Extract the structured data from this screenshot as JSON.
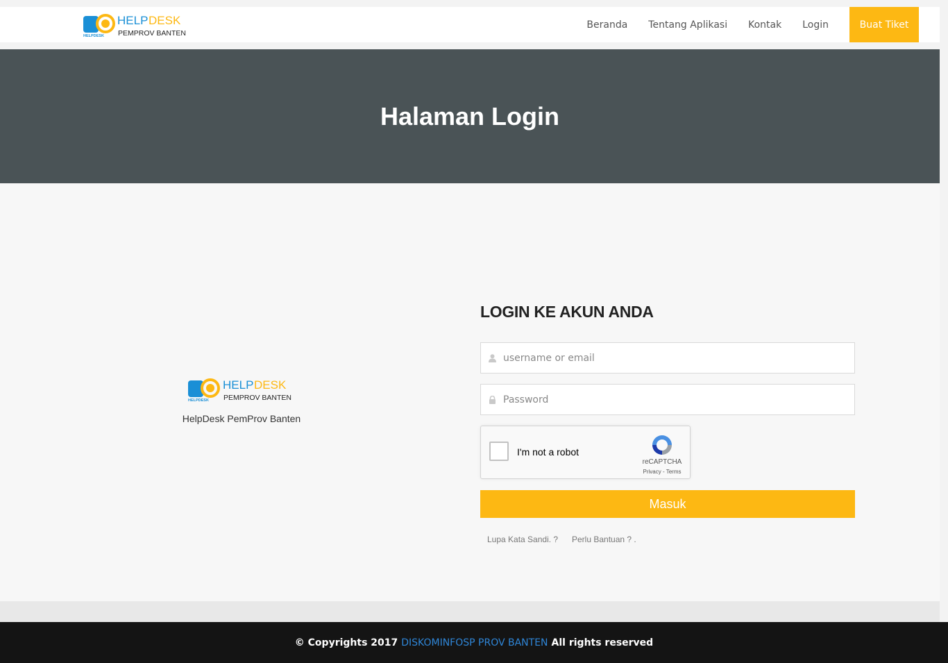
{
  "navbar": {
    "logo_text_1": "HELP",
    "logo_text_2": "DESK",
    "logo_sub": "PEMPROV BANTEN",
    "logo_badge": "HELPDESK",
    "links": [
      "Beranda",
      "Tentang Aplikasi",
      "Kontak",
      "Login"
    ],
    "cta": "Buat Tiket"
  },
  "hero": {
    "title": "Halaman Login"
  },
  "brand": {
    "logo_text_1": "HELP",
    "logo_text_2": "DESK",
    "logo_sub": "PEMPROV BANTEN",
    "logo_badge": "HELPDESK",
    "caption": "HelpDesk PemProv Banten"
  },
  "login": {
    "title": "LOGIN KE AKUN ANDA",
    "username_placeholder": "username or email",
    "password_placeholder": "Password",
    "captcha_label": "I'm not a robot",
    "captcha_brand": "reCAPTCHA",
    "captcha_links": "Privacy - Terms",
    "submit": "Masuk",
    "forgot": "Lupa Kata Sandi. ?",
    "help": "Perlu Bantuan ? ."
  },
  "footer": {
    "prefix": "© Copyrights 2017",
    "org": "DISKOMINFOSP PROV BANTEN",
    "suffix": "All rights reserved"
  },
  "colors": {
    "accent": "#fdb813",
    "hero_bg": "#4a5356",
    "footer_bg": "#141414",
    "link_blue": "#2f86d8",
    "logo_blue": "#1a8fd6"
  },
  "icons": {
    "username": "user-icon",
    "password": "lock-icon",
    "captcha": "recaptcha-logo-icon"
  }
}
